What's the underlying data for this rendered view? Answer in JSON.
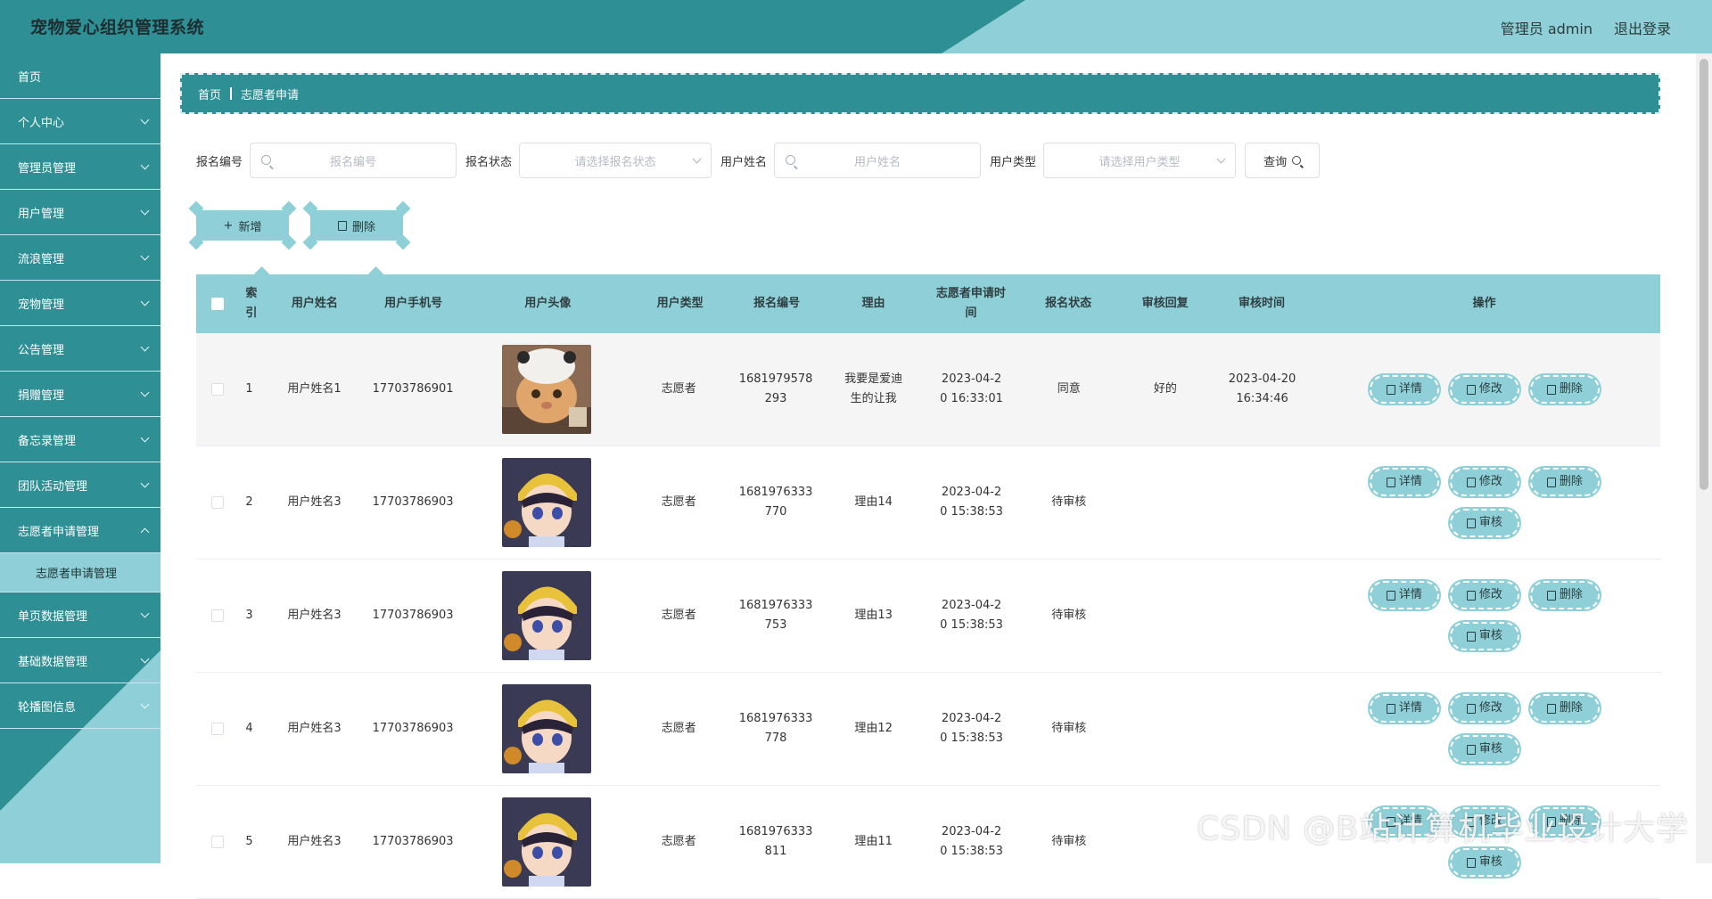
{
  "header": {
    "title": "宠物爱心组织管理系统",
    "user": "管理员 admin",
    "logout": "退出登录"
  },
  "sidebar": {
    "items": [
      {
        "label": "首页",
        "expandable": false
      },
      {
        "label": "个人中心",
        "expandable": true
      },
      {
        "label": "管理员管理",
        "expandable": true
      },
      {
        "label": "用户管理",
        "expandable": true
      },
      {
        "label": "流浪管理",
        "expandable": true
      },
      {
        "label": "宠物管理",
        "expandable": true
      },
      {
        "label": "公告管理",
        "expandable": true
      },
      {
        "label": "捐赠管理",
        "expandable": true
      },
      {
        "label": "备忘录管理",
        "expandable": true
      },
      {
        "label": "团队活动管理",
        "expandable": true
      },
      {
        "label": "志愿者申请管理",
        "expandable": true,
        "open": true
      },
      {
        "label": "单页数据管理",
        "expandable": true
      },
      {
        "label": "基础数据管理",
        "expandable": true
      },
      {
        "label": "轮播图信息",
        "expandable": true
      }
    ],
    "active_sub": "志愿者申请管理"
  },
  "breadcrumb": {
    "home": "首页",
    "current": "志愿者申请"
  },
  "search": {
    "code_label": "报名编号",
    "code_placeholder": "报名编号",
    "status_label": "报名状态",
    "status_placeholder": "请选择报名状态",
    "name_label": "用户姓名",
    "name_placeholder": "用户姓名",
    "type_label": "用户类型",
    "type_placeholder": "请选择用户类型",
    "query": "查询"
  },
  "actions": {
    "add": "新增",
    "delete": "删除"
  },
  "table": {
    "columns": [
      "索引",
      "用户姓名",
      "用户手机号",
      "用户头像",
      "用户类型",
      "报名编号",
      "理由",
      "志愿者申请时间",
      "报名状态",
      "审核回复",
      "审核时间",
      "操作"
    ],
    "ops": {
      "detail": "详情",
      "edit": "修改",
      "delete": "删除",
      "review": "审核"
    },
    "rows": [
      {
        "idx": "1",
        "name": "用户姓名1",
        "phone": "17703786901",
        "avatar": "cat",
        "type": "志愿者",
        "code": "1681979578293",
        "reason": "我要是爱迪生的让我",
        "time": "2023-04-20 16:33:01",
        "status": "同意",
        "reply": "好的",
        "rtime": "2023-04-20 16:34:46",
        "review": false
      },
      {
        "idx": "2",
        "name": "用户姓名3",
        "phone": "17703786903",
        "avatar": "anime",
        "type": "志愿者",
        "code": "1681976333770",
        "reason": "理由14",
        "time": "2023-04-20 15:38:53",
        "status": "待审核",
        "reply": "",
        "rtime": "",
        "review": true
      },
      {
        "idx": "3",
        "name": "用户姓名3",
        "phone": "17703786903",
        "avatar": "anime",
        "type": "志愿者",
        "code": "1681976333753",
        "reason": "理由13",
        "time": "2023-04-20 15:38:53",
        "status": "待审核",
        "reply": "",
        "rtime": "",
        "review": true
      },
      {
        "idx": "4",
        "name": "用户姓名3",
        "phone": "17703786903",
        "avatar": "anime",
        "type": "志愿者",
        "code": "1681976333778",
        "reason": "理由12",
        "time": "2023-04-20 15:38:53",
        "status": "待审核",
        "reply": "",
        "rtime": "",
        "review": true
      },
      {
        "idx": "5",
        "name": "用户姓名3",
        "phone": "17703786903",
        "avatar": "anime",
        "type": "志愿者",
        "code": "1681976333811",
        "reason": "理由11",
        "time": "2023-04-20 15:38:53",
        "status": "待审核",
        "reply": "",
        "rtime": "",
        "review": true
      }
    ]
  },
  "watermark": "CSDN @B站计算机毕业设计大学",
  "colors": {
    "primary": "#2e8f95",
    "accent": "#8fd0d8"
  }
}
